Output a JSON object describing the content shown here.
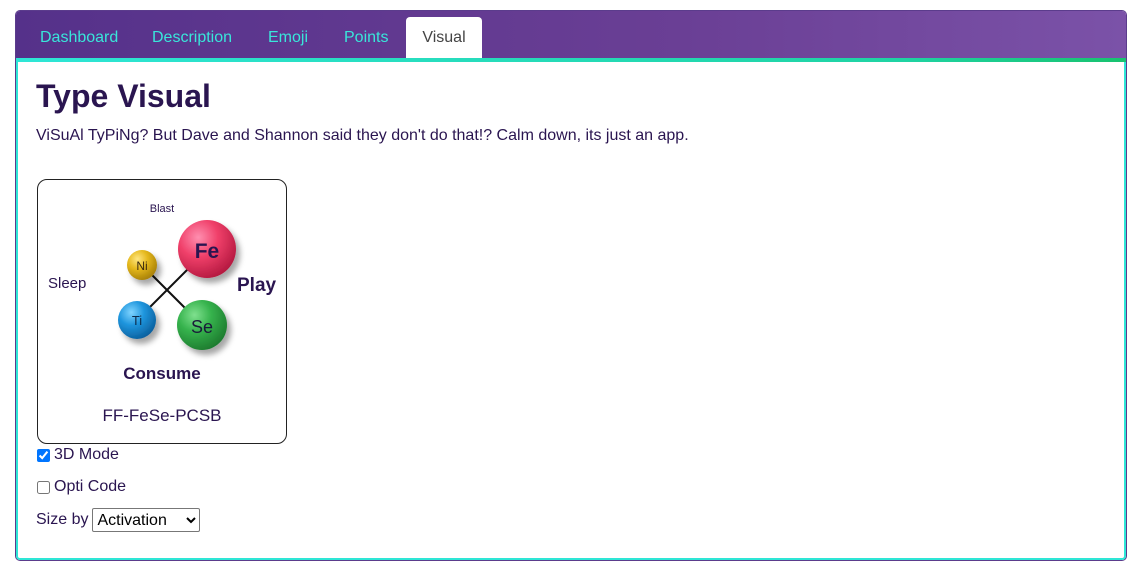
{
  "tabs": [
    {
      "label": "Dashboard",
      "active": false
    },
    {
      "label": "Description",
      "active": false
    },
    {
      "label": "Emoji",
      "active": false
    },
    {
      "label": "Points",
      "active": false
    },
    {
      "label": "Visual",
      "active": true
    }
  ],
  "page": {
    "title": "Type Visual",
    "subtitle": "ViSuAl TyPiNg? But Dave and Shannon said they don't do that!? Calm down, its just an app."
  },
  "visual": {
    "labels": {
      "top": "Blast",
      "left": "Sleep",
      "right": "Play",
      "bottom": "Consume"
    },
    "nodes": {
      "fe": "Fe",
      "se": "Se",
      "ni": "Ni",
      "ti": "Ti"
    },
    "code": "FF-FeSe-PCSB"
  },
  "controls": {
    "mode3d_label": "3D Mode",
    "mode3d_checked": true,
    "opti_label": "Opti Code",
    "opti_checked": false,
    "sizeby_label": "Size by",
    "sizeby_value": "Activation"
  },
  "colors": {
    "tab_text": "#39e6da",
    "accent": "#2ee6d6",
    "heading": "#2a1550",
    "fe": "#e8365f",
    "se": "#2fa545",
    "ni": "#e0b51b",
    "ti": "#1c8fd8"
  }
}
